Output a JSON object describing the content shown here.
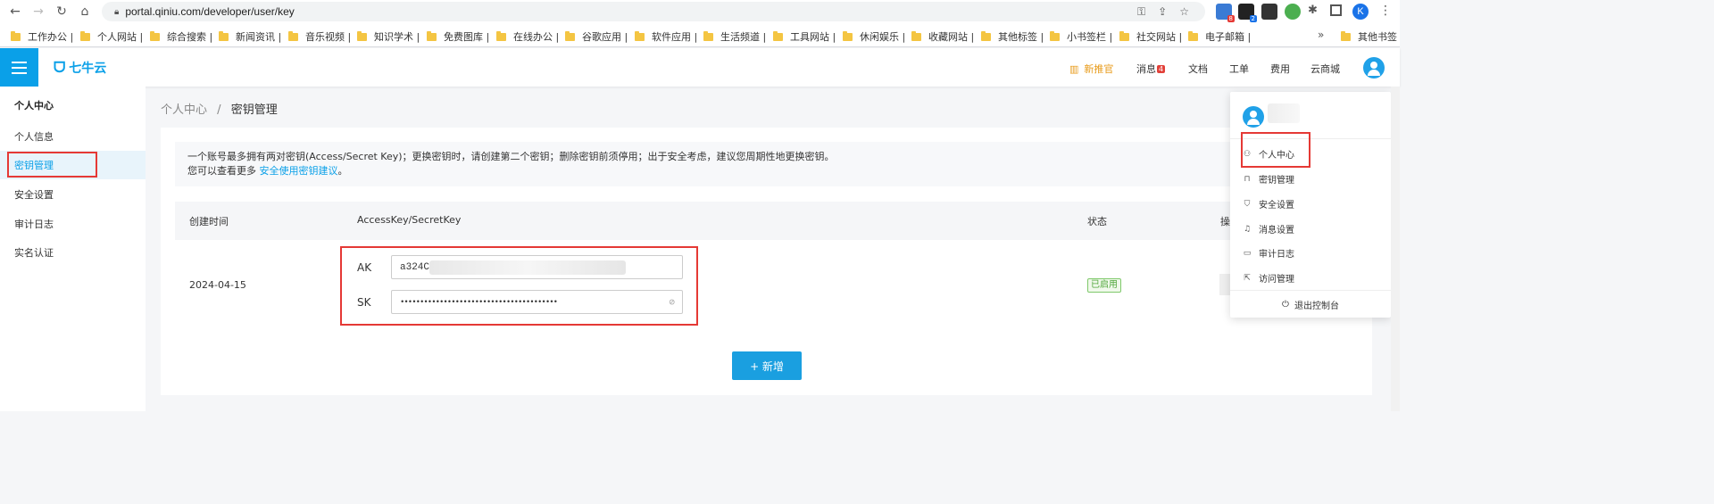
{
  "browser": {
    "url": "portal.qiniu.com/developer/user/key",
    "profile_initial": "K",
    "ext_badges": [
      "8",
      "2"
    ],
    "bookmarks": [
      "工作办公 |",
      "个人网站 |",
      "综合搜索 |",
      "新闻资讯 |",
      "音乐视频 |",
      "知识学术 |",
      "免费图库 |",
      "在线办公 |",
      "谷歌应用 |",
      "软件应用 |",
      "生活频道 |",
      "工具网站 |",
      "休闲娱乐 |",
      "收藏网站 |",
      "其他标签 |",
      "小书签栏 |",
      "社交网站 |",
      "电子邮箱 |"
    ],
    "bookmarks_more": "»",
    "other_bookmarks": "其他书签"
  },
  "header": {
    "logo": "七牛云",
    "promo": "新推官",
    "messages": "消息",
    "message_count": "4",
    "docs": "文档",
    "ticket": "工单",
    "billing": "费用",
    "mall": "云商城"
  },
  "sidebar": {
    "title": "个人中心",
    "items": [
      "个人信息",
      "密钥管理",
      "安全设置",
      "审计日志",
      "实名认证"
    ]
  },
  "breadcrumb": {
    "root": "个人中心",
    "sep": "/",
    "current": "密钥管理"
  },
  "notice": {
    "line1": "一个账号最多拥有两对密钥(Access/Secret Key)；更换密钥时，请创建第二个密钥；删除密钥前须停用；出于安全考虑，建议您周期性地更换密钥。",
    "line2_prefix": "您可以查看更多",
    "line2_link": "安全使用密钥建议",
    "line2_suffix": "。"
  },
  "table": {
    "headers": [
      "创建时间",
      "AccessKey/SecretKey",
      "状态",
      "操"
    ],
    "row": {
      "created": "2024-04-15",
      "ak_label": "AK",
      "ak_value": "a324C",
      "sk_label": "SK",
      "sk_value": "••••••••••••••••••••••••••••••••••••••••",
      "status": "已启用"
    }
  },
  "add_button": "+ 新增",
  "dropdown": {
    "items": [
      {
        "icon": "user-icon",
        "label": "个人中心"
      },
      {
        "icon": "lock-icon",
        "label": "密钥管理"
      },
      {
        "icon": "shield-icon",
        "label": "安全设置"
      },
      {
        "icon": "bell-icon",
        "label": "消息设置"
      },
      {
        "icon": "monitor-icon",
        "label": "审计日志"
      },
      {
        "icon": "access-icon",
        "label": "访问管理"
      }
    ],
    "logout": "退出控制台"
  },
  "colors": {
    "brand": "#0aa0e8",
    "highlight": "#e53935",
    "status_green": "#52a83d"
  }
}
